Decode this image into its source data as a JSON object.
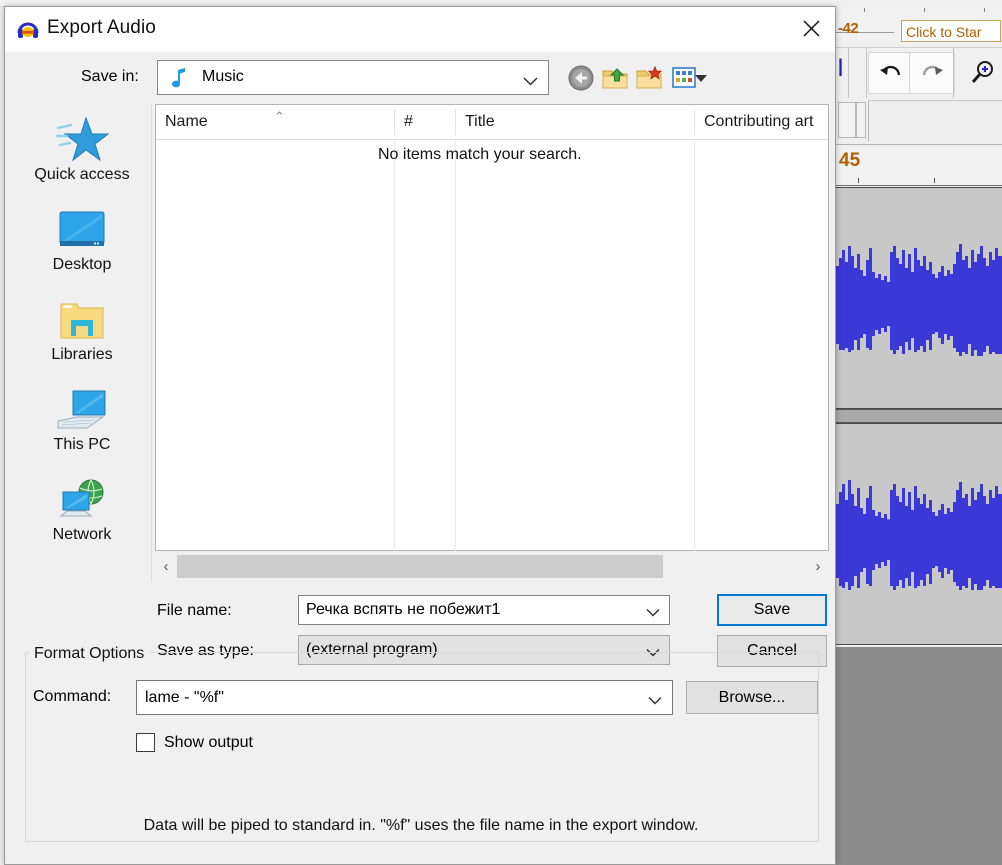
{
  "dialog": {
    "title": "Export Audio",
    "title_icon": "audacity-headphones-icon",
    "close_icon": "close-icon",
    "save_in_label": "Save in:",
    "save_in_value": "Music",
    "save_in_icon": "music-note-icon",
    "nav_buttons": [
      {
        "name": "back-button",
        "icon": "back-arrow-icon"
      },
      {
        "name": "up-one-level-button",
        "icon": "folder-up-icon"
      },
      {
        "name": "new-folder-button",
        "icon": "new-folder-icon"
      },
      {
        "name": "views-button",
        "icon": "views-grid-icon"
      },
      {
        "name": "views-dropdown-button",
        "icon": "chevron-down-icon"
      }
    ],
    "places": [
      {
        "label": "Quick access",
        "icon": "star-icon"
      },
      {
        "label": "Desktop",
        "icon": "monitor-icon"
      },
      {
        "label": "Libraries",
        "icon": "folder-icon"
      },
      {
        "label": "This PC",
        "icon": "computer-icon"
      },
      {
        "label": "Network",
        "icon": "globe-monitor-icon"
      }
    ],
    "file_list": {
      "columns": [
        "Name",
        "#",
        "Title",
        "Contributing art"
      ],
      "sort_column": "Name",
      "sort_caret": "⌃",
      "empty_message": "No items match your search.",
      "rows": []
    },
    "scrollbar": {
      "left_arrow": "‹",
      "right_arrow": "›"
    },
    "file_name_label": "File name:",
    "file_name_value": "Речка вспять не побежит1",
    "save_as_type_label": "Save as type:",
    "save_as_type_value": "(external program)",
    "save_button": "Save",
    "cancel_button": "Cancel",
    "format_options": {
      "legend": "Format Options",
      "command_label": "Command:",
      "command_value": "lame - \"%f\"",
      "browse_button": "Browse...",
      "show_output_label": "Show output",
      "show_output_checked": false
    },
    "hint": "Data will be piped to standard in. \"%f\" uses the file name in the export window."
  },
  "background": {
    "meter_value": "-42",
    "tooltip": "Click to Star",
    "timeline_label": "45",
    "undo_icon": "undo-icon",
    "redo_icon": "redo-icon",
    "zoom_in_icon": "zoom-in-icon",
    "waveform_color": "#3b38d8",
    "track_background": "#c8c8c8"
  },
  "colors": {
    "accent": "#0078d7",
    "dialog_bg": "#f0f0f0",
    "field_bg": "#ffffff",
    "meter_text": "#b06000"
  }
}
